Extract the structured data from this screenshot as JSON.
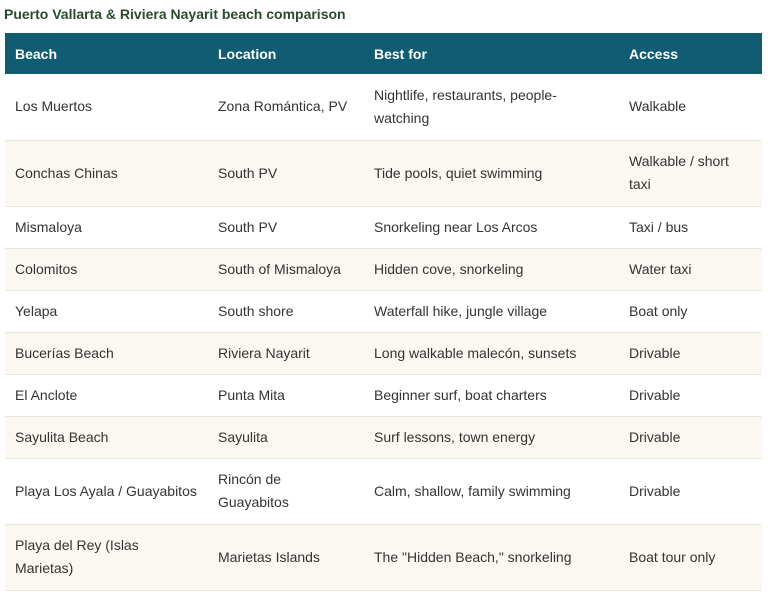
{
  "caption": "Puerto Vallarta & Riviera Nayarit beach comparison",
  "columns": [
    "Beach",
    "Location",
    "Best for",
    "Access"
  ],
  "rows": [
    [
      "Los Muertos",
      "Zona Romántica, PV",
      "Nightlife, restaurants, people-watching",
      "Walkable"
    ],
    [
      "Conchas Chinas",
      "South PV",
      "Tide pools, quiet swimming",
      "Walkable / short taxi"
    ],
    [
      "Mismaloya",
      "South PV",
      "Snorkeling near Los Arcos",
      "Taxi / bus"
    ],
    [
      "Colomitos",
      "South of Mismaloya",
      "Hidden cove, snorkeling",
      "Water taxi"
    ],
    [
      "Yelapa",
      "South shore",
      "Waterfall hike, jungle village",
      "Boat only"
    ],
    [
      "Bucerías Beach",
      "Riviera Nayarit",
      "Long walkable malecón, sunsets",
      "Drivable"
    ],
    [
      "El Anclote",
      "Punta Mita",
      "Beginner surf, boat charters",
      "Drivable"
    ],
    [
      "Sayulita Beach",
      "Sayulita",
      "Surf lessons, town energy",
      "Drivable"
    ],
    [
      "Playa Los Ayala / Guayabitos",
      "Rincón de Guayabitos",
      "Calm, shallow, family swimming",
      "Drivable"
    ],
    [
      "Playa del Rey (Islas Marietas)",
      "Marietas Islands",
      "The \"Hidden Beach,\" snorkeling",
      "Boat tour only"
    ]
  ]
}
